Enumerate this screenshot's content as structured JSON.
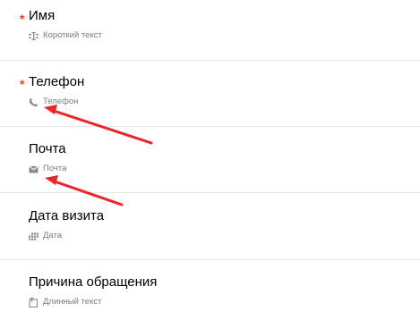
{
  "fields": [
    {
      "title": "Имя",
      "required": "*",
      "type_label": "Короткий текст",
      "type_icon": "short-text-icon"
    },
    {
      "title": "Телефон",
      "required": "*",
      "type_label": "Телефон",
      "type_icon": "phone-icon"
    },
    {
      "title": "Почта",
      "type_label": "Почта",
      "type_icon": "envelope-icon"
    },
    {
      "title": "Дата визита",
      "type_label": "Дата",
      "type_icon": "calendar-icon"
    },
    {
      "title": "Причина обращения",
      "type_label": "Длинный текст",
      "type_icon": "long-text-icon"
    }
  ],
  "colors": {
    "required_star": "#f23a2a",
    "annotation_arrow": "#e8262b",
    "secondary_text": "#7d7d7d",
    "divider": "#e6e6e6"
  },
  "annotations": [
    {
      "type": "arrow",
      "points_to": "Телефон type label"
    },
    {
      "type": "arrow",
      "points_to": "Почта type label"
    }
  ]
}
